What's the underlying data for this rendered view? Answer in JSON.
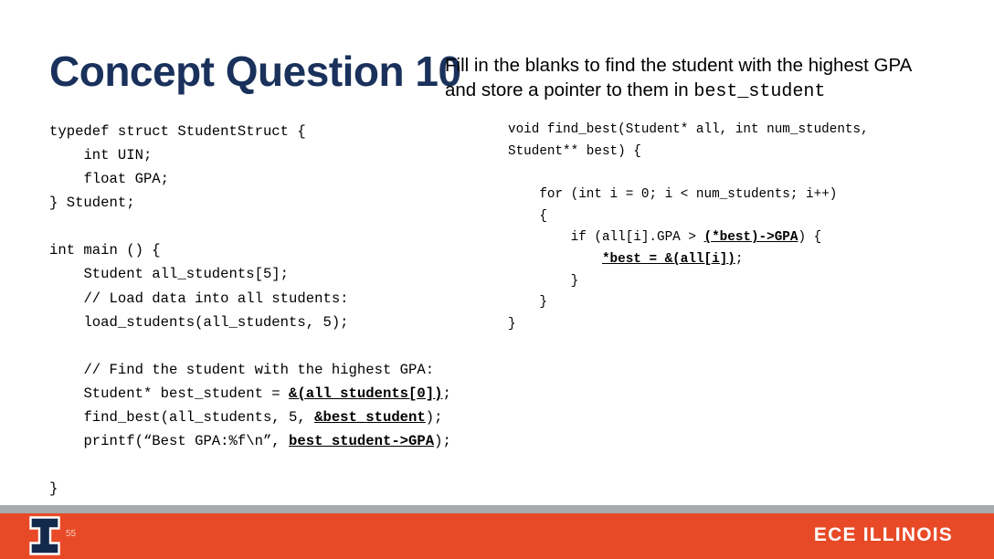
{
  "slide": {
    "title": "Concept Question 10",
    "subtitle_text": "Fill in the blanks to find the student with the highest GPA and store a pointer to them in ",
    "subtitle_mono": "best_student",
    "page_number": "55"
  },
  "colors": {
    "title_navy": "#19315B",
    "illinois_orange": "#E84A27",
    "footer_gray": "#A7ABAB",
    "logo_navy": "#13294B",
    "text_black": "#000000",
    "footer_text_white": "#FFFFFF"
  },
  "code_left": {
    "lines": [
      "typedef struct StudentStruct {",
      "    int UIN;",
      "    float GPA;",
      "} Student;",
      "",
      "int main () {",
      "    Student all_students[5];",
      "    // Load data into all students:",
      "    load_students(all_students, 5);",
      "",
      "    // Find the student with the highest GPA:",
      "    Student* best_student = ",
      "    find_best(all_students, 5, ",
      "    printf(“Best GPA:%f\\n”, ",
      "}"
    ],
    "answer_1": "&(all_students[0])",
    "answer_1_tail": ";",
    "answer_2": "&best_student",
    "answer_2_tail": ");",
    "answer_3": "best_student->GPA",
    "answer_3_tail": ");"
  },
  "code_right": {
    "signature": "void find_best(Student* all, int num_students, Student** best) {",
    "for_line": "    for (int i = 0; i < num_students; i++)",
    "for_brace": "    {",
    "if_prefix": "        if (all[i].GPA > ",
    "if_answer": "(*best)->GPA",
    "if_tail": ") {",
    "assign_answer": "*best = &(all[i])",
    "assign_tail": ";",
    "close_inner": "        }",
    "close_for": "    }",
    "close_fn": "}"
  },
  "footer": {
    "brand": "ECE ILLINOIS",
    "logo_letter": "I"
  }
}
